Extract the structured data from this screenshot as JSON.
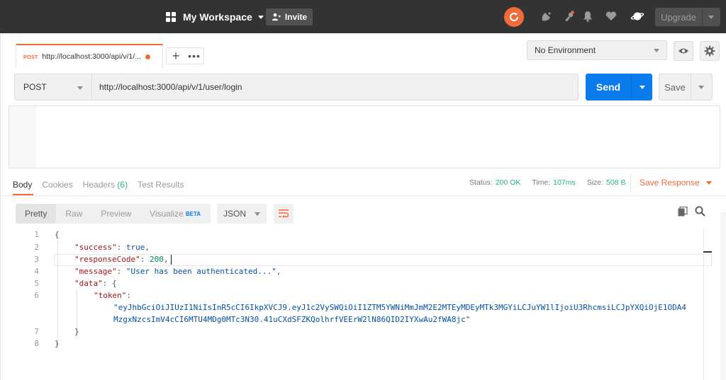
{
  "topbar": {
    "workspace_label": "My Workspace",
    "invite_label": "Invite",
    "upgrade_label": "Upgrade",
    "icons": [
      "grid-icon",
      "sync-icon",
      "satellite-icon",
      "notification-bell-icon",
      "heart-icon",
      "planet-icon"
    ]
  },
  "tabs": {
    "active_tab": {
      "method": "POST",
      "title": "http://localhost:3000/api/v/1/...",
      "unsaved": true
    },
    "add_label": "+",
    "more_label": "•••"
  },
  "environment": {
    "selected": "No Environment"
  },
  "request": {
    "method": "POST",
    "url": "http://localhost:3000/api/v/1/user/login",
    "send_label": "Send",
    "save_label": "Save"
  },
  "response": {
    "tabs": [
      {
        "label": "Body",
        "active": true
      },
      {
        "label": "Cookies",
        "active": false
      },
      {
        "label": "Headers",
        "count": "(6)",
        "active": false
      },
      {
        "label": "Test Results",
        "active": false
      }
    ],
    "status_label": "Status:",
    "status_value": "200 OK",
    "time_label": "Time:",
    "time_value": "107ms",
    "size_label": "Size:",
    "size_value": "508 B",
    "save_response_label": "Save Response",
    "formats": [
      {
        "label": "Pretty",
        "active": true
      },
      {
        "label": "Raw",
        "active": false
      },
      {
        "label": "Preview",
        "active": false
      },
      {
        "label": "Visualize",
        "active": false,
        "badge": "BETA"
      }
    ],
    "language": "JSON",
    "code_lines": [
      {
        "no": "1",
        "text": "{"
      },
      {
        "no": "2",
        "key": "\"success\"",
        "value": "true",
        "vtype": "bool",
        "trail": ","
      },
      {
        "no": "3",
        "key": "\"responseCode\"",
        "value": "200",
        "vtype": "num",
        "trail": ","
      },
      {
        "no": "4",
        "key": "\"message\"",
        "value": "\"User has been authenticated...\"",
        "vtype": "str",
        "trail": ","
      },
      {
        "no": "5",
        "key": "\"data\"",
        "value": "{",
        "vtype": "punct",
        "trail": ""
      },
      {
        "no": "6",
        "key": "\"token\"",
        "value": "",
        "vtype": "punct",
        "trail": ""
      },
      {
        "no": "",
        "text": "\"eyJhbGciOiJIUzI1NiIsInR5cCI6IkpXVCJ9.eyJ1c2VySWQiOiI1ZTM5YWNiMmJmM2E2MTEyMDEyMTk3MGYiLCJuYW1lIjoiU3RhcmsiLCJpYXQiOjE1ODA4",
        "vtype": "str"
      },
      {
        "no": "",
        "text": "MzgxNzcsImV4cCI6MTU4MDg0MTc3N30.41uCXdSFZKQolhrfVEErW2lN86QID2IYXwAu2fWA8jc\"",
        "vtype": "str"
      },
      {
        "no": "7",
        "text": "}"
      },
      {
        "no": "8",
        "text": "}"
      }
    ]
  },
  "colors": {
    "accent": "#f26b3a",
    "send_blue": "#097bed",
    "status_green": "#26b47f",
    "topbar": "#333333"
  }
}
